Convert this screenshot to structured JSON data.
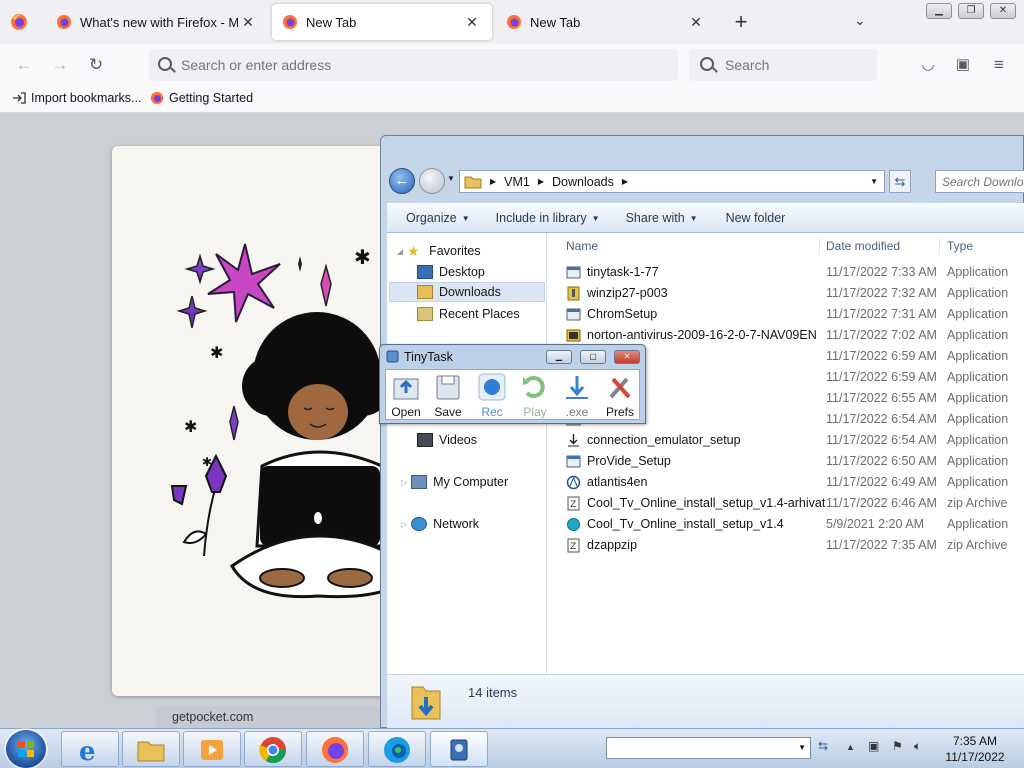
{
  "browser": {
    "tabs": [
      {
        "title": "What's new with Firefox - More",
        "active": false
      },
      {
        "title": "New Tab",
        "active": true
      },
      {
        "title": "New Tab",
        "active": false
      }
    ],
    "url_placeholder": "Search or enter address",
    "search_placeholder": "Search",
    "bookmarks": [
      "Import bookmarks...",
      "Getting Started"
    ]
  },
  "page": {
    "pocket_source": "getpocket.com"
  },
  "explorer": {
    "breadcrumb": [
      "VM1",
      "Downloads"
    ],
    "search_placeholder": "Search Downloads",
    "commands": [
      "Organize",
      "Include in library",
      "Share with",
      "New folder"
    ],
    "nav": {
      "favorites": "Favorites",
      "favorites_items": [
        "Desktop",
        "Downloads",
        "Recent Places"
      ],
      "libraries_items": [
        "Videos"
      ],
      "computer": "My Computer",
      "network": "Network"
    },
    "columns": {
      "name": "Name",
      "date": "Date modified",
      "type": "Type"
    },
    "files": [
      {
        "name": "tinytask-1-77",
        "date": "11/17/2022 7:33 AM",
        "type": "Application",
        "icon": "app-icon"
      },
      {
        "name": "winzip27-p003",
        "date": "11/17/2022 7:32 AM",
        "type": "Application",
        "icon": "winzip-icon"
      },
      {
        "name": "ChromSetup",
        "date": "11/17/2022 7:31 AM",
        "type": "Application",
        "icon": "app-icon"
      },
      {
        "name": "norton-antivirus-2009-16-2-0-7-NAV09EN",
        "date": "11/17/2022 7:02 AM",
        "type": "Application",
        "icon": "norton-icon"
      },
      {
        "name": "",
        "date": "11/17/2022 6:59 AM",
        "type": "Application",
        "icon": "app-icon"
      },
      {
        "name": "",
        "date": "11/17/2022 6:59 AM",
        "type": "Application",
        "icon": "app-icon"
      },
      {
        "name": "",
        "date": "11/17/2022 6:55 AM",
        "type": "Application",
        "icon": "app-icon"
      },
      {
        "name": "",
        "date": "11/17/2022 6:54 AM",
        "type": "Application",
        "icon": "app-icon"
      },
      {
        "name": "connection_emulator_setup",
        "date": "11/17/2022 6:54 AM",
        "type": "Application",
        "icon": "installer-icon"
      },
      {
        "name": "ProVide_Setup",
        "date": "11/17/2022 6:50 AM",
        "type": "Application",
        "icon": "app-icon"
      },
      {
        "name": "atlantis4en",
        "date": "11/17/2022 6:49 AM",
        "type": "Application",
        "icon": "atlantis-icon"
      },
      {
        "name": "Cool_Tv_Online_install_setup_v1.4-arhivat",
        "date": "11/17/2022 6:46 AM",
        "type": "zip Archive",
        "icon": "zip-icon"
      },
      {
        "name": "Cool_Tv_Online_install_setup_v1.4",
        "date": "5/9/2021 2:20 AM",
        "type": "Application",
        "icon": "tv-icon"
      },
      {
        "name": "dzappzip",
        "date": "11/17/2022 7:35 AM",
        "type": "zip Archive",
        "icon": "zip-icon"
      }
    ],
    "items_count": "14 items"
  },
  "tinytask": {
    "title": "TinyTask",
    "tools": [
      "Open",
      "Save",
      "Rec",
      "Play",
      ".exe",
      "Prefs"
    ]
  },
  "taskbar": {
    "time": "7:35 AM",
    "date": "11/17/2022"
  }
}
